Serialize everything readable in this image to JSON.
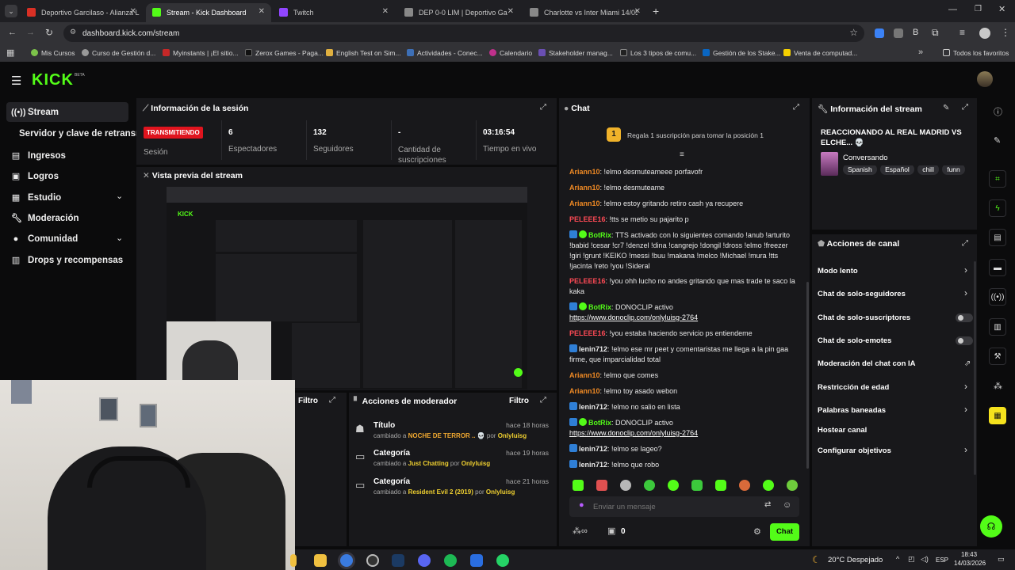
{
  "browser": {
    "tabs": [
      {
        "label": "Deportivo Garcilaso - Alianza L",
        "fav": "#d93025"
      },
      {
        "label": "Stream - Kick Dashboard",
        "fav": "#53fc18"
      },
      {
        "label": "Twitch",
        "fav": "#9146ff"
      },
      {
        "label": "DEP 0-0 LIM | Deportivo Garcila",
        "fav": "#bbbbbb"
      },
      {
        "label": "Charlotte vs Inter Miami 14/03/",
        "fav": "#bbbbbb"
      }
    ],
    "url": "dashboard.kick.com/stream",
    "bookmarks": [
      {
        "label": "Mis Cursos",
        "color": "#7cc24a"
      },
      {
        "label": "Curso de Gestión d...",
        "color": "#999999"
      },
      {
        "label": "Myinstants | ¡El sitio...",
        "color": "#c62828"
      },
      {
        "label": "Zerox Games - Paga...",
        "color": "#111111"
      },
      {
        "label": "English Test on Sim...",
        "color": "#e0b040"
      },
      {
        "label": "Actividades - Conec...",
        "color": "#3d6fb6"
      },
      {
        "label": "Calendario",
        "color": "#c0308c"
      },
      {
        "label": "Stakeholder manag...",
        "color": "#6a4fb3"
      },
      {
        "label": "Los 3 tipos de comu...",
        "color": "#222222"
      },
      {
        "label": "Gestión de los Stake...",
        "color": "#0a66c2"
      },
      {
        "label": "Venta de computad...",
        "color": "#f5d000"
      }
    ],
    "all_favorites": "Todos los favoritos"
  },
  "brand": {
    "logo": "KICK",
    "beta": "BETA",
    "accent": "#53fc18"
  },
  "sidebar": {
    "items": [
      {
        "label": "Stream",
        "icon": "broadcast-icon"
      },
      {
        "label": "Servidor y clave de retransmisión",
        "icon": ""
      },
      {
        "label": "Ingresos",
        "icon": "income-icon"
      },
      {
        "label": "Logros",
        "icon": "trophy-icon"
      },
      {
        "label": "Estudio",
        "icon": "studio-icon"
      },
      {
        "label": "Moderación",
        "icon": "wrench-icon"
      },
      {
        "label": "Comunidad",
        "icon": "community-icon"
      },
      {
        "label": "Drops y recompensas",
        "icon": "gift-icon"
      }
    ]
  },
  "session": {
    "title": "Información de la sesión",
    "live_badge": "TRANSMITIENDO",
    "session_label": "Sesión",
    "stats": [
      {
        "value": "6",
        "label": "Espectadores"
      },
      {
        "value": "132",
        "label": "Seguidores"
      },
      {
        "value": "-",
        "label": "Cantidad de suscripciones"
      },
      {
        "value": "03:16:54",
        "label": "Tiempo en vivo"
      }
    ]
  },
  "preview": {
    "title": "Vista previa del stream"
  },
  "mod_panel": {
    "filter_left": "Filtro",
    "title": "Acciones de moderador",
    "filter": "Filtro",
    "items": [
      {
        "title": "Título",
        "desc_prefix": "cambiado a ",
        "value": "NOCHE DE TERROR .. 💀",
        "by": " por ",
        "user": "Onlyluisg",
        "time": "hace 18 horas"
      },
      {
        "title": "Categoría",
        "desc_prefix": "cambiado a ",
        "value": "Just Chatting",
        "by": " por ",
        "user": "Onlyluisg",
        "time": "hace 19 horas"
      },
      {
        "title": "Categoría",
        "desc_prefix": "cambiado a ",
        "value": "Resident Evil 2 (2019)",
        "by": " por ",
        "user": "Onlyluisg",
        "time": "hace 21 horas"
      }
    ]
  },
  "chat": {
    "title": "Chat",
    "gift_rank": "1",
    "gift_text": "Regala 1 suscripción para tomar la posición 1",
    "messages": [
      {
        "user": "Ariann10",
        "color": "orange",
        "text": "!elmo desmuteameee porfavofr",
        "badges": ""
      },
      {
        "user": "Ariann10",
        "color": "orange",
        "text": "!elmo desmuteame",
        "badges": ""
      },
      {
        "user": "Ariann10",
        "color": "orange",
        "text": "!elmo estoy gritando retiro cash ya recupere",
        "badges": ""
      },
      {
        "user": "PELEEE16",
        "color": "red",
        "text": "!tts se metio su pajarito p",
        "badges": ""
      },
      {
        "user": "BotRix",
        "color": "green",
        "text": "TTS activado con lo siguientes comando !anub !arturito !babid !cesar !cr7 !denzel !dina !cangrejo !dongil !dross !elmo !freezer !giri !grunt !KEIKO !messi !buu !makana !melco !Michael !mura !tts !jacinta !reto !you !Sideral",
        "badges": "bot"
      },
      {
        "user": "PELEEE16",
        "color": "red",
        "text": "!you ohh lucho no andes gritando que mas trade te saco la kaka",
        "badges": ""
      },
      {
        "user": "BotRix",
        "color": "green",
        "text": "DONOCLIP activo",
        "link": "https://www.donoclip.com/onlyluisg-2764",
        "badges": "bot"
      },
      {
        "user": "PELEEE16",
        "color": "red",
        "text": "!you estaba haciendo servicio ps entiendeme",
        "badges": ""
      },
      {
        "user": "lenin712",
        "color": "white",
        "text": "!elmo ese mr peet y comentaristas me llega a la pin gaa firme, que imparcialidad total",
        "badges": "sub"
      },
      {
        "user": "Ariann10",
        "color": "orange",
        "text": "!elmo que comes",
        "badges": ""
      },
      {
        "user": "Ariann10",
        "color": "orange",
        "text": "!elmo toy asado webon",
        "badges": ""
      },
      {
        "user": "lenin712",
        "color": "white",
        "text": "!elmo no salio en lista",
        "badges": "sub"
      },
      {
        "user": "BotRix",
        "color": "green",
        "text": "DONOCLIP activo",
        "link": "https://www.donoclip.com/onlyluisg-2764",
        "badges": "bot"
      },
      {
        "user": "lenin712",
        "color": "white",
        "text": "!elmo se lageo?",
        "badges": "sub"
      },
      {
        "user": "lenin712",
        "color": "white",
        "text": "!elmo que robo",
        "badges": "sub"
      }
    ],
    "placeholder": "Enviar un mensaje",
    "points": "0",
    "send": "Chat"
  },
  "stream_info": {
    "title": "Información del stream",
    "stream_title": "REACCIONANDO AL REAL MADRID VS ELCHE... 💀",
    "category": "Conversando",
    "tags": [
      "Spanish",
      "Español",
      "chill",
      "funn"
    ]
  },
  "channel_actions": {
    "title": "Acciones de canal",
    "items": [
      {
        "label": "Modo lento",
        "kind": "chevron"
      },
      {
        "label": "Chat de solo-seguidores",
        "kind": "chevron"
      },
      {
        "label": "Chat de solo-suscriptores",
        "kind": "toggle"
      },
      {
        "label": "Chat de solo-emotes",
        "kind": "toggle"
      },
      {
        "label": "Moderación del chat con IA",
        "kind": "external"
      },
      {
        "label": "Restricción de edad",
        "kind": "chevron"
      },
      {
        "label": "Palabras baneadas",
        "kind": "chevron"
      },
      {
        "label": "Hostear canal",
        "kind": "none"
      },
      {
        "label": "Configurar objetivos",
        "kind": "chevron"
      }
    ]
  },
  "taskbar": {
    "weather": "20°C  Despejado",
    "lang": "ESP",
    "time": "18:43",
    "date": "14/03/2026"
  }
}
